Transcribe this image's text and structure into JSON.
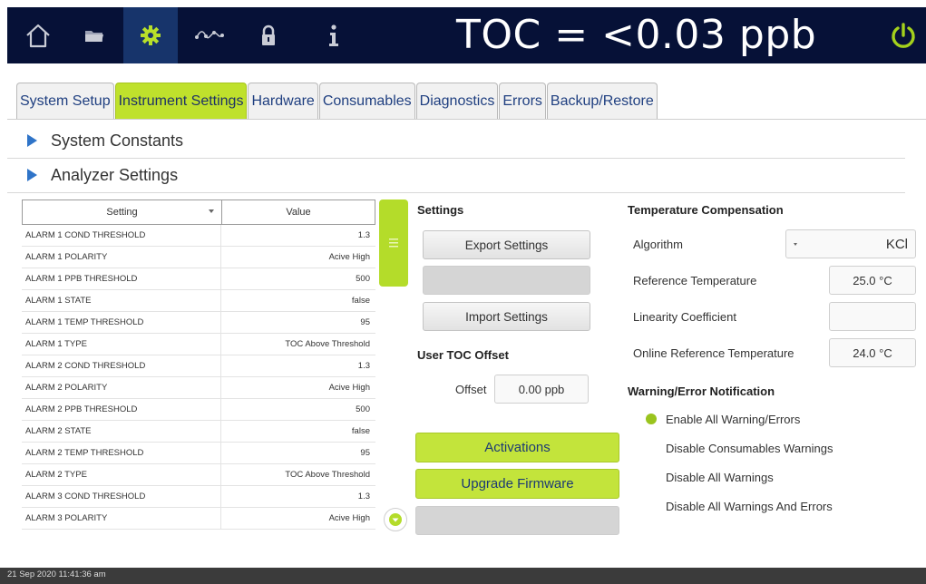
{
  "header": {
    "toc_display": "TOC = <0.03 ppb",
    "nav": [
      {
        "icon": "home-icon"
      },
      {
        "icon": "folder-icon"
      },
      {
        "icon": "gear-icon"
      },
      {
        "icon": "trend-icon"
      },
      {
        "icon": "lock-icon"
      },
      {
        "icon": "info-icon"
      }
    ],
    "active_nav": "gear-icon",
    "power_icon": "power-icon"
  },
  "tabs": [
    {
      "label": "System Setup"
    },
    {
      "label": "Instrument Settings",
      "active": true
    },
    {
      "label": "Hardware"
    },
    {
      "label": "Consumables"
    },
    {
      "label": "Diagnostics"
    },
    {
      "label": "Errors"
    },
    {
      "label": "Backup/Restore"
    }
  ],
  "accordion": {
    "system_constants": "System Constants",
    "analyzer_settings": "Analyzer Settings"
  },
  "table": {
    "col_setting": "Setting",
    "col_value": "Value",
    "rows": [
      {
        "setting": "ALARM 1 COND THRESHOLD",
        "value": "1.3"
      },
      {
        "setting": "ALARM 1 POLARITY",
        "value": "Acive High"
      },
      {
        "setting": "ALARM 1 PPB THRESHOLD",
        "value": "500"
      },
      {
        "setting": "ALARM 1 STATE",
        "value": "false"
      },
      {
        "setting": "ALARM 1 TEMP THRESHOLD",
        "value": "95"
      },
      {
        "setting": "ALARM 1 TYPE",
        "value": "TOC Above Threshold"
      },
      {
        "setting": "ALARM 2 COND THRESHOLD",
        "value": "1.3"
      },
      {
        "setting": "ALARM 2 POLARITY",
        "value": "Acive High"
      },
      {
        "setting": "ALARM 2 PPB THRESHOLD",
        "value": "500"
      },
      {
        "setting": "ALARM 2 STATE",
        "value": "false"
      },
      {
        "setting": "ALARM 2 TEMP THRESHOLD",
        "value": "95"
      },
      {
        "setting": "ALARM 2 TYPE",
        "value": "TOC Above Threshold"
      },
      {
        "setting": "ALARM 3 COND THRESHOLD",
        "value": "1.3"
      },
      {
        "setting": "ALARM 3 POLARITY",
        "value": "Acive High"
      }
    ]
  },
  "settings": {
    "title": "Settings",
    "export": "Export Settings",
    "disabled_btn": "",
    "import": "Import Settings"
  },
  "user_toc_offset": {
    "title": "User TOC Offset",
    "offset_label": "Offset",
    "offset_value": "0.00 ppb"
  },
  "actions": {
    "activations": "Activations",
    "upgrade_firmware": "Upgrade Firmware",
    "disabled_btn": ""
  },
  "temperature_compensation": {
    "title": "Temperature Compensation",
    "algorithm_label": "Algorithm",
    "algorithm_value": "KCl",
    "ref_temp_label": "Reference Temperature",
    "ref_temp_value": "25.0 °C",
    "linearity_label": "Linearity Coefficient",
    "linearity_value": "",
    "online_ref_temp_label": "Online Reference Temperature",
    "online_ref_temp_value": "24.0 °C"
  },
  "notification": {
    "title": "Warning/Error Notification",
    "options": [
      {
        "label": "Enable All Warning/Errors",
        "selected": true
      },
      {
        "label": "Disable Consumables Warnings",
        "selected": false
      },
      {
        "label": "Disable All Warnings",
        "selected": false
      },
      {
        "label": "Disable All Warnings And Errors",
        "selected": false
      }
    ]
  },
  "footer": {
    "timestamp": "21 Sep 2020  11:41:36 am"
  },
  "colors": {
    "header_bg": "#061137",
    "accent_green": "#bfe12c",
    "power_green": "#a4d11c",
    "tab_text": "#1f3f80",
    "triangle_blue": "#2f74c8"
  }
}
